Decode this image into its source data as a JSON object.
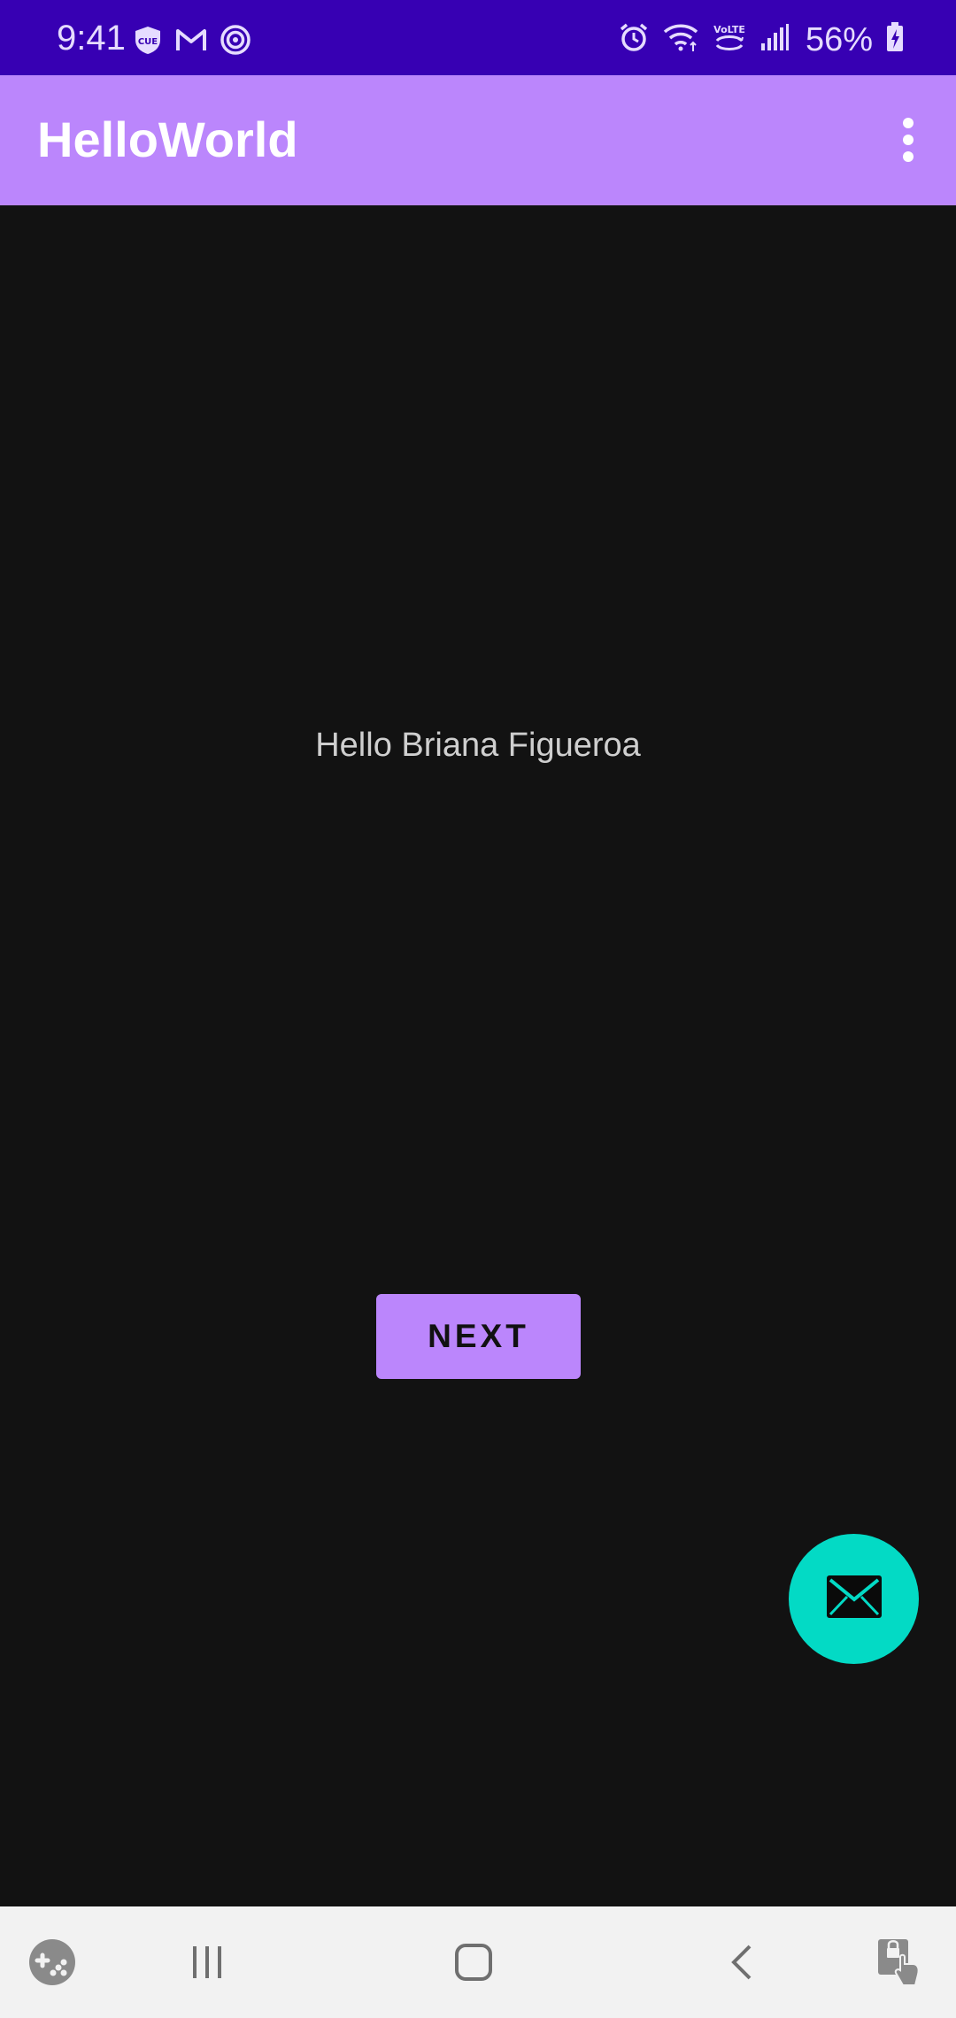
{
  "status_bar": {
    "time": "9:41",
    "battery": "56%",
    "left_icons": [
      "cue-shield-icon",
      "gmail-icon",
      "target-icon"
    ],
    "right_icons": [
      "alarm-icon",
      "wifi-icon",
      "volte-icon",
      "signal-icon",
      "battery-charging-icon"
    ]
  },
  "app_bar": {
    "title": "HelloWorld",
    "menu_icon": "overflow-menu-icon"
  },
  "main": {
    "greeting": "Hello Briana Figueroa",
    "next_button": "NEXT"
  },
  "fab": {
    "icon": "mail-icon"
  },
  "nav_bar": {
    "items": [
      "game-launcher-icon",
      "recents-icon",
      "home-icon",
      "back-icon",
      "screen-pinning-icon"
    ]
  },
  "colors": {
    "status_bar": "#3700b3",
    "app_bar": "#bb86fc",
    "background": "#121212",
    "fab": "#03dac5",
    "nav_bar": "#f2f2f2"
  }
}
